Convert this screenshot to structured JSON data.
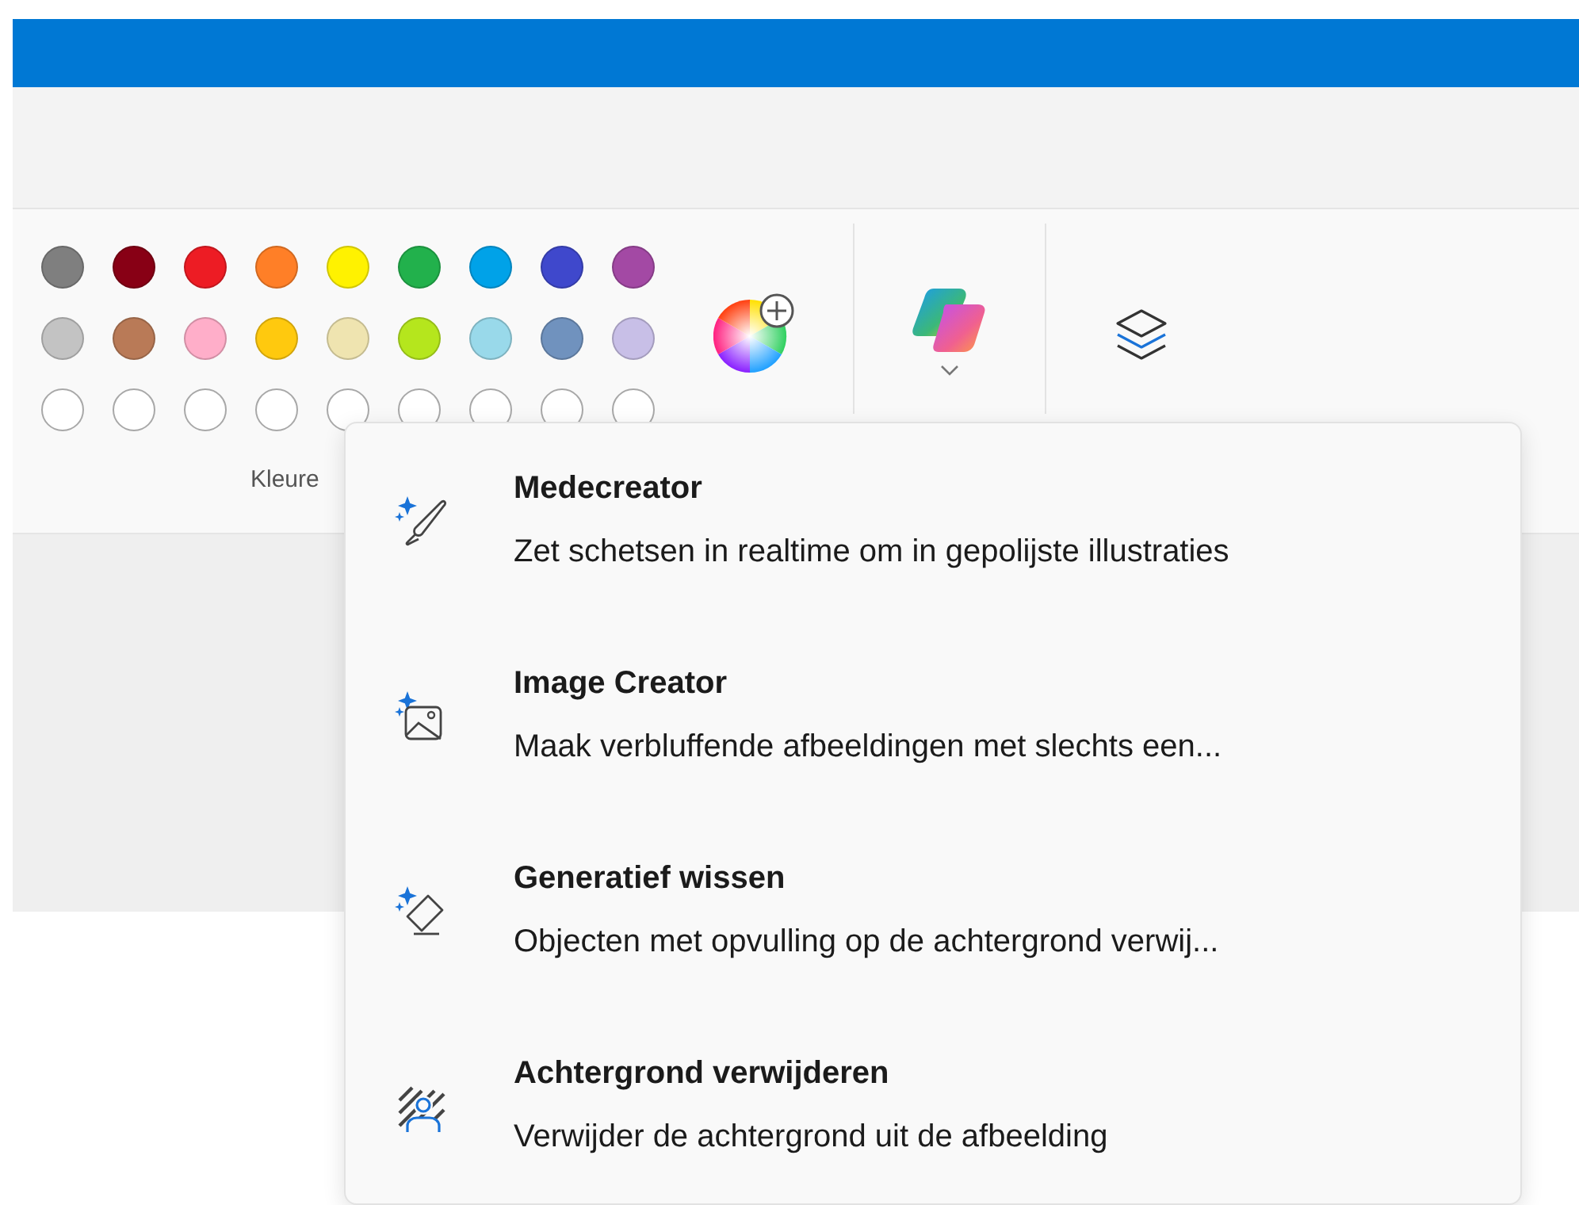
{
  "palette": {
    "rows": [
      [
        {
          "kind": "filled",
          "color": "#7f7f7f"
        },
        {
          "kind": "filled",
          "color": "#880015"
        },
        {
          "kind": "filled",
          "color": "#ed1c24"
        },
        {
          "kind": "filled",
          "color": "#ff7f27"
        },
        {
          "kind": "filled",
          "color": "#fff200"
        },
        {
          "kind": "filled",
          "color": "#22b14c"
        },
        {
          "kind": "filled",
          "color": "#00a2e8"
        },
        {
          "kind": "filled",
          "color": "#3f48cc"
        },
        {
          "kind": "filled",
          "color": "#a349a4"
        }
      ],
      [
        {
          "kind": "filled",
          "color": "#c3c3c3"
        },
        {
          "kind": "filled",
          "color": "#b97a57"
        },
        {
          "kind": "filled",
          "color": "#ffaec9"
        },
        {
          "kind": "filled",
          "color": "#ffc90e"
        },
        {
          "kind": "filled",
          "color": "#efe4b0"
        },
        {
          "kind": "filled",
          "color": "#b5e61d"
        },
        {
          "kind": "filled",
          "color": "#99d9ea"
        },
        {
          "kind": "filled",
          "color": "#7092be"
        },
        {
          "kind": "filled",
          "color": "#c8bfe7"
        }
      ],
      [
        {
          "kind": "empty"
        },
        {
          "kind": "empty"
        },
        {
          "kind": "empty"
        },
        {
          "kind": "empty"
        },
        {
          "kind": "empty"
        },
        {
          "kind": "empty"
        },
        {
          "kind": "empty"
        },
        {
          "kind": "empty"
        },
        {
          "kind": "empty"
        }
      ]
    ],
    "label": "Kleure"
  },
  "menu": {
    "items": [
      {
        "kind": "brush",
        "title": "Medecreator",
        "description": "Zet schetsen in realtime om in gepolijste illustraties"
      },
      {
        "kind": "image",
        "title": "Image Creator",
        "description": "Maak verbluffende afbeeldingen met slechts een..."
      },
      {
        "kind": "eraser",
        "title": "Generatief wissen",
        "description": "Objecten met opvulling op de achtergrond verwij..."
      },
      {
        "kind": "person",
        "title": "Achtergrond verwijderen",
        "description": "Verwijder de achtergrond uit de afbeelding"
      }
    ]
  }
}
